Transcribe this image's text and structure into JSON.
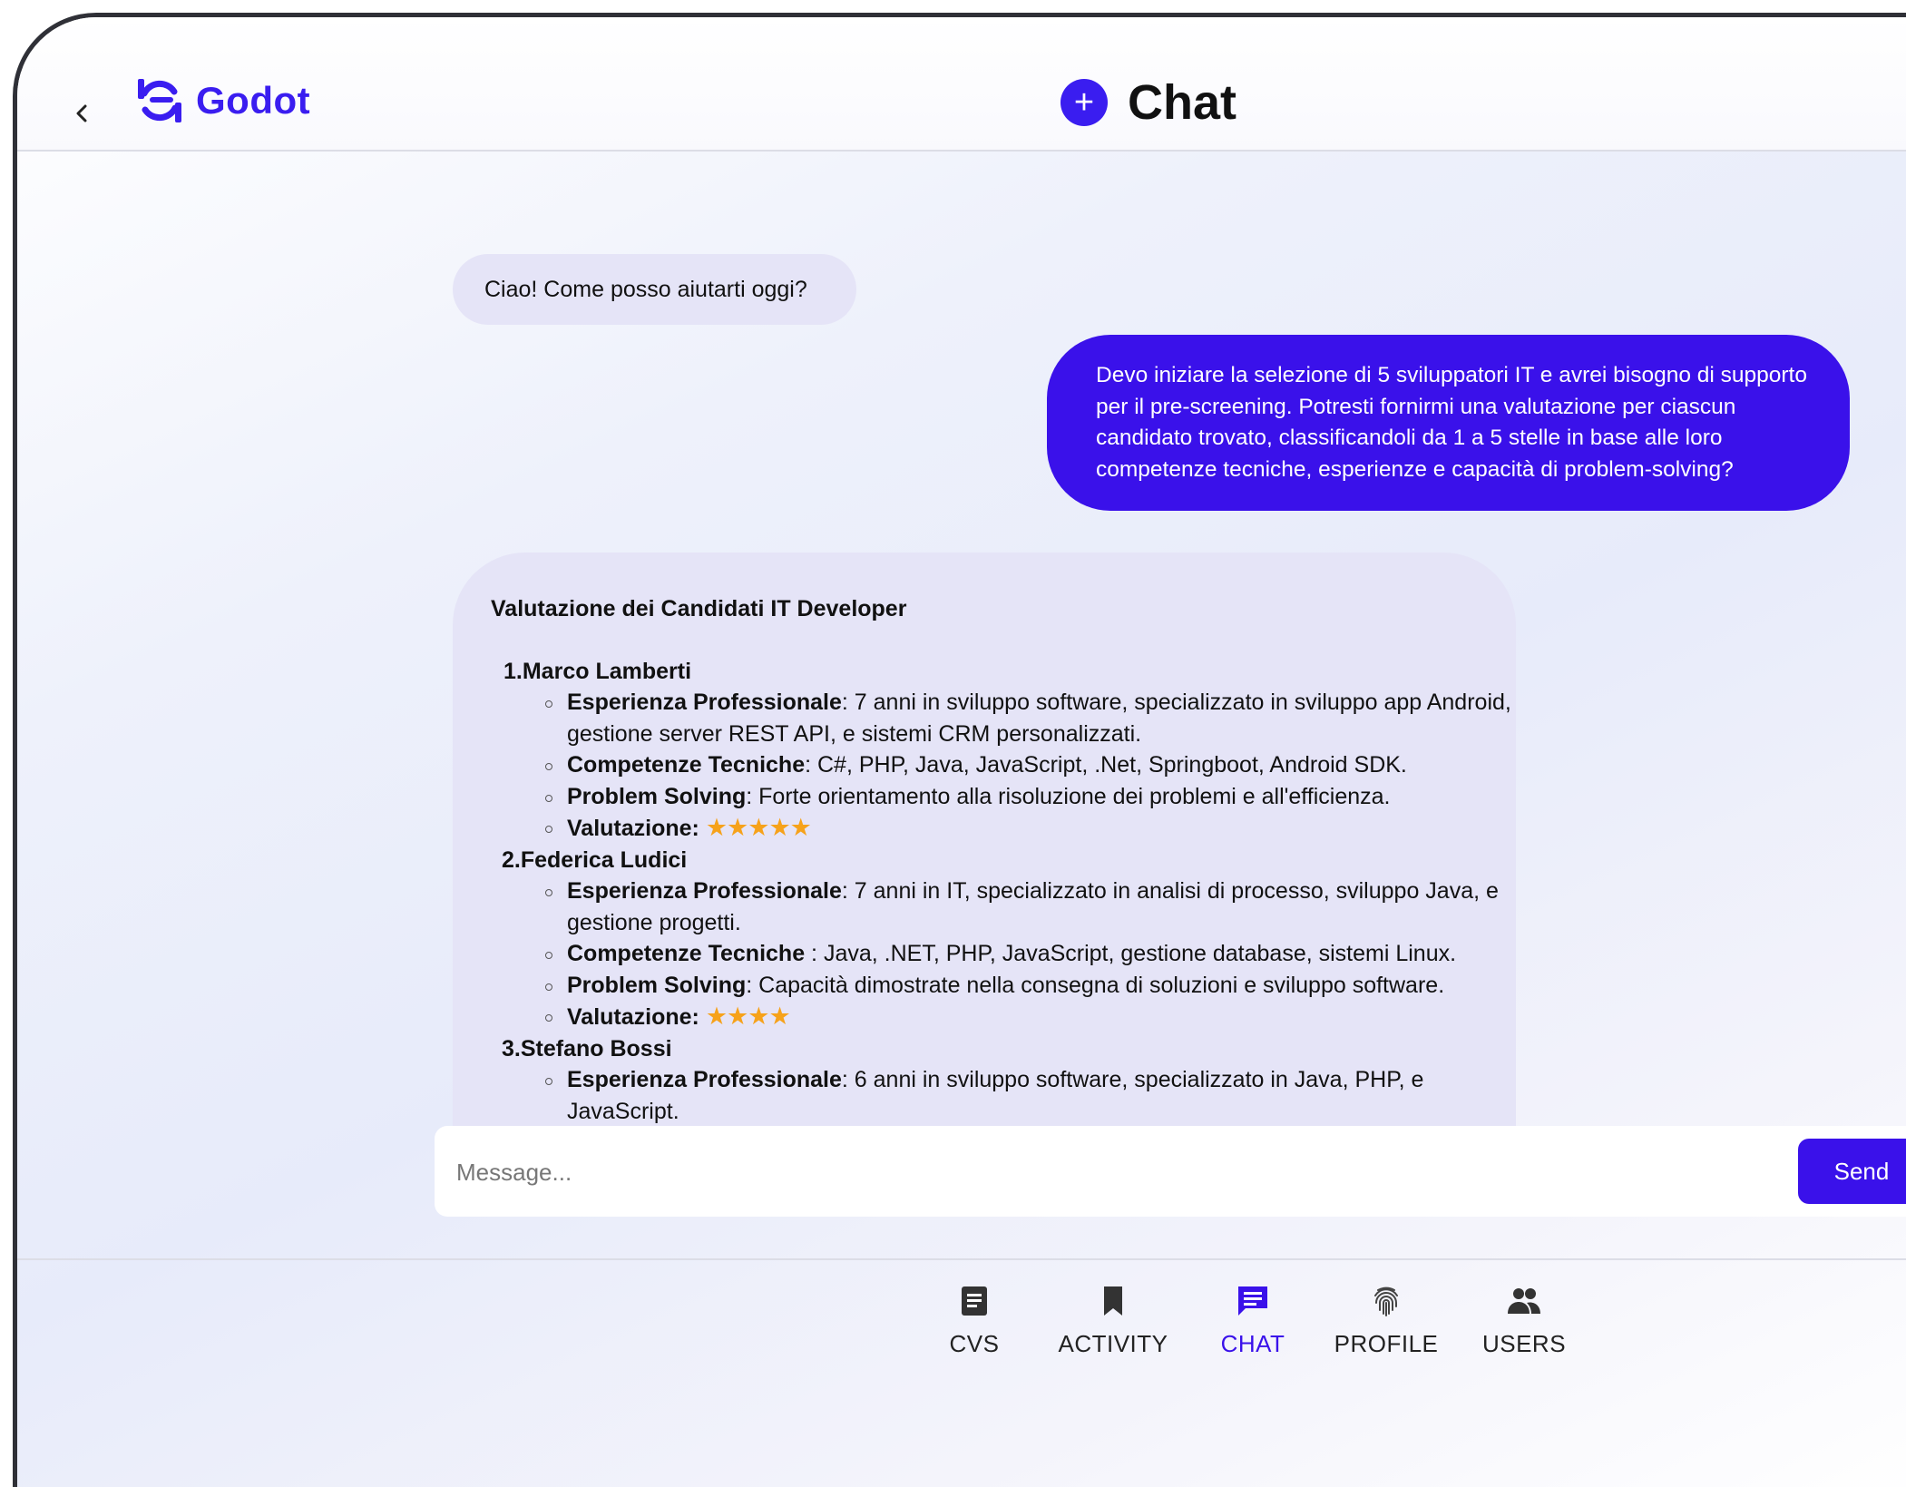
{
  "header": {
    "app_name": "Godot",
    "title": "Chat",
    "new_chat_symbol": "+"
  },
  "messages": {
    "greeting": "Ciao! Come posso aiutarti oggi?",
    "user_request": "Devo iniziare la selezione di 5 sviluppatori IT e avrei bisogno di supporto per il pre-screening. Potresti fornirmi una valutazione per ciascun candidato trovato, classificandoli da 1 a 5 stelle in base alle loro competenze tecniche, esperienze e capacità di problem-solving?",
    "response": {
      "heading": "Valutazione dei Candidati IT Developer",
      "candidates": [
        {
          "num": "1.",
          "name": "Marco Lamberti",
          "experience_label": "Esperienza Professionale",
          "experience": ": 7 anni in sviluppo software, specializzato in sviluppo app Android, gestione server REST API, e sistemi CRM personalizzati.",
          "skills_label": "Competenze Tecniche",
          "skills": ": C#, PHP, Java, JavaScript, .Net, Springboot, Android SDK.",
          "problem_label": "Problem Solving",
          "problem": ": Forte orientamento alla risoluzione dei problemi e all'efficienza.",
          "rating_label": "Valutazione:",
          "rating_stars": "★★★★★",
          "rating": 5
        },
        {
          "num": "2.",
          "name": "Federica Ludici",
          "experience_label": "Esperienza Professionale",
          "experience": ": 7 anni in IT, specializzato in analisi di processo, sviluppo Java, e gestione progetti.",
          "skills_label": "Competenze Tecniche",
          "skills": " : Java, .NET, PHP, JavaScript, gestione database, sistemi Linux.",
          "problem_label": "Problem Solving",
          "problem": ": Capacità dimostrate nella consegna di soluzioni e sviluppo software.",
          "rating_label": "Valutazione:",
          "rating_stars": "★★★★",
          "rating": 4
        },
        {
          "num": "3.",
          "name": "Stefano Bossi",
          "experience_label": "Esperienza Professionale",
          "experience": ": 6 anni in sviluppo software, specializzato in Java, PHP, e JavaScript."
        }
      ]
    }
  },
  "composer": {
    "placeholder": "Message...",
    "send_label": "Send"
  },
  "nav": {
    "items": [
      {
        "label": "CVS",
        "icon": "document-icon"
      },
      {
        "label": "ACTIVITY",
        "icon": "bookmark-icon"
      },
      {
        "label": "CHAT",
        "icon": "chat-icon",
        "active": true
      },
      {
        "label": "PROFILE",
        "icon": "fingerprint-icon"
      },
      {
        "label": "USERS",
        "icon": "users-icon"
      }
    ]
  },
  "colors": {
    "accent": "#3a11ea",
    "bot_bubble": "#e5e4f7",
    "star": "#f6a21b"
  }
}
